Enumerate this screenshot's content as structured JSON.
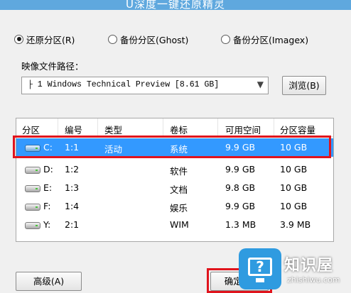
{
  "window": {
    "title": "U深度一键还原精灵"
  },
  "mode_options": [
    {
      "label": "还原分区(R)",
      "selected": true
    },
    {
      "label": "备份分区(Ghost)",
      "selected": false
    },
    {
      "label": "备份分区(Imagex)",
      "selected": false
    }
  ],
  "image_path": {
    "label": "映像文件路径：",
    "value": "├ 1 Windows Technical Preview [8.61 GB]",
    "browse_label": "浏览(B)"
  },
  "partition_table": {
    "columns": [
      "分区",
      "编号",
      "类型",
      "卷标",
      "可用空间",
      "分区容量"
    ],
    "rows": [
      {
        "drive": "C:",
        "id": "1:1",
        "type": "活动",
        "label": "系统",
        "free": "9.9 GB",
        "size": "10 GB",
        "selected": true
      },
      {
        "drive": "D:",
        "id": "1:2",
        "type": "",
        "label": "软件",
        "free": "9.9 GB",
        "size": "10 GB",
        "selected": false
      },
      {
        "drive": "E:",
        "id": "1:3",
        "type": "",
        "label": "文档",
        "free": "9.8 GB",
        "size": "10 GB",
        "selected": false
      },
      {
        "drive": "F:",
        "id": "1:4",
        "type": "",
        "label": "娱乐",
        "free": "9.9 GB",
        "size": "10 GB",
        "selected": false
      },
      {
        "drive": "Y:",
        "id": "2:1",
        "type": "",
        "label": "WIM",
        "free": "1.3 MB",
        "size": "3.9 MB",
        "selected": false
      }
    ]
  },
  "buttons": {
    "advanced": "高级(A)",
    "confirm": "确定(Y)"
  },
  "watermark": {
    "name": "知识屋",
    "url": "zhishiwu.com",
    "icon": "monitor-question-icon"
  },
  "colors": {
    "title_bar": "#5fa8de",
    "selection": "#3399ff",
    "highlight_box": "#e0141d",
    "watermark_blue": "#2f9be0"
  }
}
